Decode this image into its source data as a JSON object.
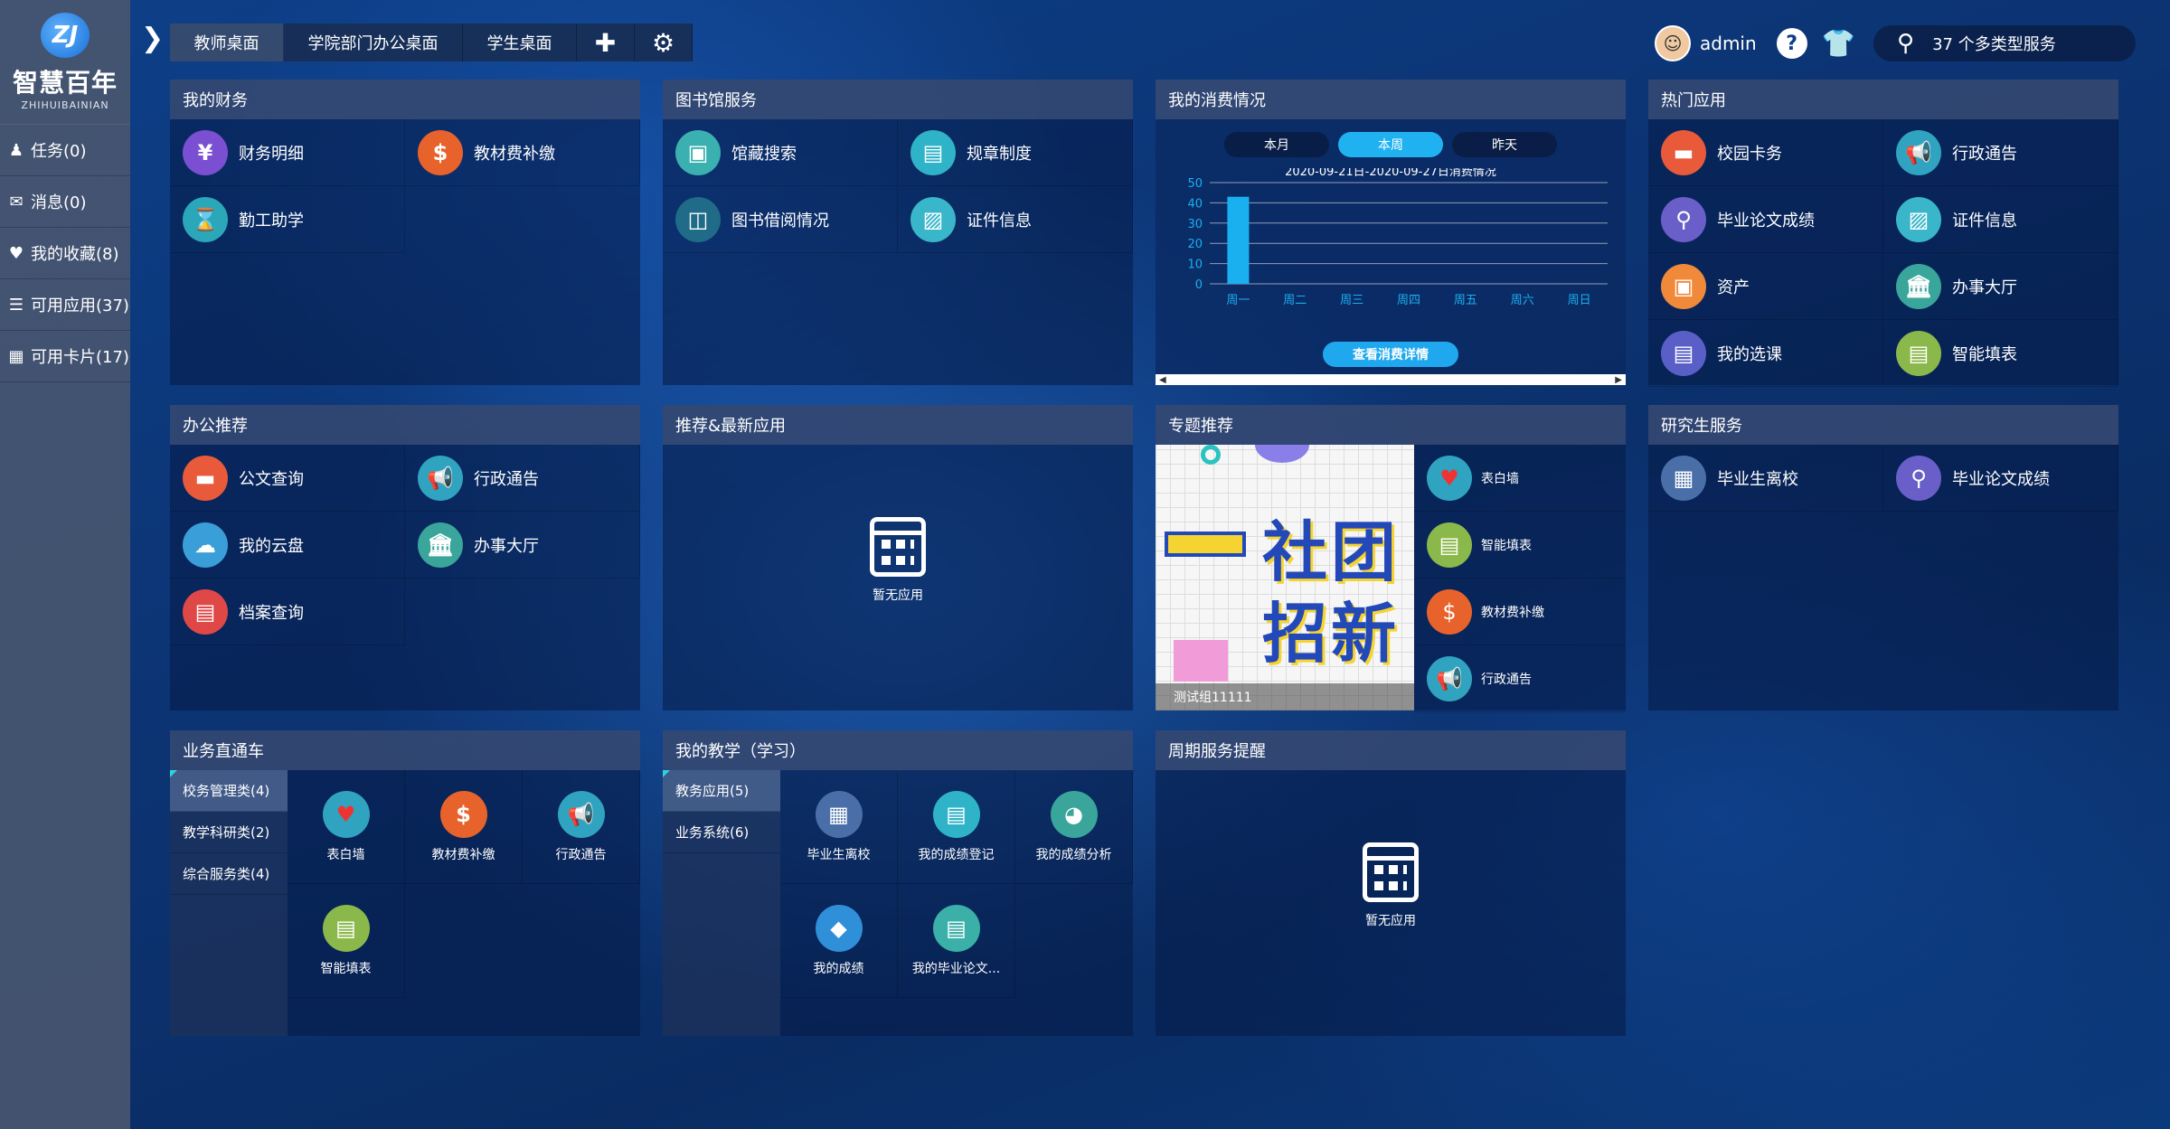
{
  "brand": {
    "name": "智慧百年",
    "sub": "ZHIHUIBAINIAN",
    "mark": "ZJ"
  },
  "sidebar": {
    "items": [
      {
        "label": "任务(0)",
        "icon": "user-icon"
      },
      {
        "label": "消息(0)",
        "icon": "chat-icon"
      },
      {
        "label": "我的收藏(8)",
        "icon": "heart-icon"
      },
      {
        "label": "可用应用(37)",
        "icon": "list-icon"
      },
      {
        "label": "可用卡片(17)",
        "icon": "grid-icon"
      }
    ]
  },
  "tabs": [
    {
      "label": "教师桌面",
      "active": true
    },
    {
      "label": "学院部门办公桌面"
    },
    {
      "label": "学生桌面"
    }
  ],
  "header": {
    "username": "admin",
    "search": "37 个多类型服务"
  },
  "panels": {
    "finance": {
      "title": "我的财务",
      "items": [
        "财务明细",
        "教材费补缴",
        "勤工助学"
      ]
    },
    "library": {
      "title": "图书馆服务",
      "items": [
        "馆藏搜索",
        "规章制度",
        "图书借阅情况",
        "证件信息"
      ]
    },
    "consumption": {
      "title": "我的消费情况",
      "ranges": [
        "本月",
        "本周",
        "昨天"
      ],
      "detail": "查看消费详情"
    },
    "hot": {
      "title": "热门应用",
      "items": [
        "校园卡务",
        "行政通告",
        "毕业论文成绩",
        "证件信息",
        "资产",
        "办事大厅",
        "我的选课",
        "智能填表"
      ]
    },
    "office": {
      "title": "办公推荐",
      "items": [
        "公文查询",
        "行政通告",
        "我的云盘",
        "办事大厅",
        "档案查询"
      ]
    },
    "recommend": {
      "title": "推荐&最新应用",
      "empty": "暂无应用"
    },
    "topic": {
      "title": "专题推荐",
      "banner1": "社团",
      "banner2": "招新",
      "caption": "测试组11111",
      "items": [
        "表白墙",
        "智能填表",
        "教材费补缴",
        "行政通告"
      ]
    },
    "grad": {
      "title": "研究生服务",
      "items": [
        "毕业生离校",
        "毕业论文成绩"
      ]
    },
    "business": {
      "title": "业务直通车",
      "cats": [
        "校务管理类(4)",
        "教学科研类(2)",
        "综合服务类(4)"
      ],
      "items": [
        "表白墙",
        "教材费补缴",
        "行政通告",
        "智能填表"
      ]
    },
    "teaching": {
      "title": "我的教学（学习）",
      "cats": [
        "教务应用(5)",
        "业务系统(6)"
      ],
      "items": [
        "毕业生离校",
        "我的成绩登记",
        "我的成绩分析",
        "我的成绩",
        "我的毕业论文..."
      ]
    },
    "cycle": {
      "title": "周期服务提醒",
      "empty": "暂无应用"
    }
  },
  "chart_data": {
    "type": "bar",
    "title": "2020-09-21日-2020-09-27日消费情况",
    "categories": [
      "周一",
      "周二",
      "周三",
      "周四",
      "周五",
      "周六",
      "周日"
    ],
    "values": [
      43,
      0,
      0,
      0,
      0,
      0,
      0
    ],
    "ylim": [
      0,
      50
    ],
    "yticks": [
      "0",
      "10",
      "20",
      "30",
      "40",
      "50"
    ],
    "color": "#1ab0f0"
  }
}
